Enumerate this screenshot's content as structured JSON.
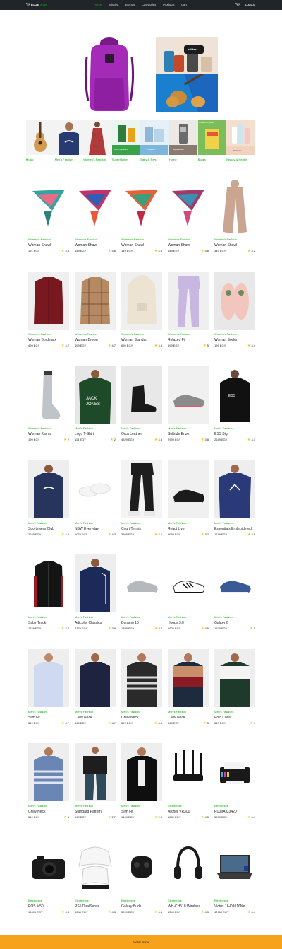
{
  "navbar": {
    "brand_fresh": "Fresh",
    "brand_cart": "Cart",
    "links": [
      "Home",
      "Wishlist",
      "Brands",
      "Categories",
      "Products",
      "Cart"
    ],
    "active_link": "Home",
    "logout": "Logout",
    "colors": {
      "bg": "#212529",
      "accent": "#0aad0a"
    }
  },
  "banners": {
    "side_top_brand": "adidas"
  },
  "categories": [
    "Music",
    "Men's Fashion",
    "Women's Fashion",
    "SuperMarket",
    "Baby & Toys",
    "Home",
    "Books",
    "Beauty & Health"
  ],
  "category_tiles": {
    "supermarket": "Food Cupboard",
    "baby": "Diapers",
    "home": "Appliances",
    "books": "Children's Books",
    "beauty": "Skincare"
  },
  "products": [
    {
      "category": "Women's Fashion",
      "name": "Woman Shawl",
      "price": "191 EGY",
      "rating": "4.8"
    },
    {
      "category": "Women's Fashion",
      "name": "Woman Shawl",
      "price": "149 EGY",
      "rating": "4.8"
    },
    {
      "category": "Women's Fashion",
      "name": "Woman Shawl",
      "price": "149 EGY",
      "rating": "4.8"
    },
    {
      "category": "Women's Fashion",
      "name": "Woman Shawl",
      "price": "149 EGY",
      "rating": "4.8"
    },
    {
      "category": "Women's Fashion",
      "name": "Woman Shawl",
      "price": "349 EGY",
      "rating": "4.2"
    },
    {
      "category": "Women's Fashion",
      "name": "Woman Bordeaux",
      "price": "499 EGY",
      "rating": "4.2"
    },
    {
      "category": "Women's Fashion",
      "name": "Woman Brown",
      "price": "499 EGY",
      "rating": "4.7"
    },
    {
      "category": "Women's Fashion",
      "name": "Woman Standart",
      "price": "699 EGY",
      "rating": "4.8"
    },
    {
      "category": "Women's Fashion",
      "name": "Relaxed Fit",
      "price": "699 EGY",
      "rating": "5"
    },
    {
      "category": "Women's Fashion",
      "name": "Woman Socks",
      "price": "199 EGY",
      "rating": "4.4"
    },
    {
      "category": "Women's Fashion",
      "name": "Woman Karma",
      "price": "199 EGY",
      "rating": "2"
    },
    {
      "category": "Men's Fashion",
      "name": "Logo T-Shirt",
      "price": "114 EGY",
      "rating": "2"
    },
    {
      "category": "Men's Fashion",
      "name": "Orca Leather",
      "price": "4829 EGY",
      "rating": "4.5"
    },
    {
      "category": "Men's Fashion",
      "name": "Softride Enzo",
      "price": "2999 EGY",
      "rating": "3.8"
    },
    {
      "category": "Men's Fashion",
      "name": "ESS Big",
      "price": "2649 EGY",
      "rating": "4.3"
    },
    {
      "category": "Men's Fashion",
      "name": "Sportswear Club",
      "price": "2649 EGY",
      "rating": "4.8"
    },
    {
      "category": "Men's Fashion",
      "name": "NSW Everyday",
      "price": "1079 EGY",
      "rating": "4.2"
    },
    {
      "category": "Men's Fashion",
      "name": "Court Tennis",
      "price": "3959 EGY",
      "rating": "2.6"
    },
    {
      "category": "Men's Fashion",
      "name": "React Live",
      "price": "4639 EGY",
      "rating": "3.7"
    },
    {
      "category": "Men's Fashion",
      "name": "Essentials Embroidered",
      "price": "1749 EGY",
      "rating": "3.8"
    },
    {
      "category": "Men's Fashion",
      "name": "Sabir Track",
      "price": "1748 EGY",
      "rating": "3.2"
    },
    {
      "category": "Men's Fashion",
      "name": "Adicolor Classics",
      "price": "2379 EGY",
      "rating": "3.8"
    },
    {
      "category": "Men's Fashion",
      "name": "Duramo 10",
      "price": "1889 EGY",
      "rating": "3.8"
    },
    {
      "category": "Men's Fashion",
      "name": "Hoops 3.0",
      "price": "1625 EGY",
      "rating": "4.5"
    },
    {
      "category": "Men's Fashion",
      "name": "Galaxy 6",
      "price": "1629 EGY",
      "rating": "5"
    },
    {
      "category": "Men's Fashion",
      "name": "Slim Fit",
      "price": "549 EGY",
      "rating": "4.7"
    },
    {
      "category": "Men's Fashion",
      "name": "Crew Neck",
      "price": "449 EGY",
      "rating": "4.7"
    },
    {
      "category": "Men's Fashion",
      "name": "Crew Neck",
      "price": "599 EGY",
      "rating": "4.5"
    },
    {
      "category": "Men's Fashion",
      "name": "Crew Neck",
      "price": "549 EGY",
      "rating": "5"
    },
    {
      "category": "Men's Fashion",
      "name": "Polo Collar",
      "price": "349 EGY",
      "rating": "4"
    },
    {
      "category": "Men's Fashion",
      "name": "Crew Neck",
      "price": "549 EGY",
      "rating": "3"
    },
    {
      "category": "Men's Fashion",
      "name": "Standard Pattern",
      "price": "699 EGY",
      "rating": "2.7"
    },
    {
      "category": "Men's Fashion",
      "name": "Slim Fit",
      "price": "1499 EGY",
      "rating": "2.6"
    },
    {
      "category": "Electronics",
      "name": "Archer VR300",
      "price": "1689 EGY",
      "rating": "4.5"
    },
    {
      "category": "Electronics",
      "name": "PIXMA G3420",
      "price": "5999 EGY",
      "rating": "4.4"
    },
    {
      "category": "Electronics",
      "name": "EOS M50",
      "price": "19699 EGY",
      "rating": "4.3"
    },
    {
      "category": "Electronics",
      "name": "PS5 DualSense",
      "price": "1048 EGY",
      "rating": "4.3"
    },
    {
      "category": "Electronics",
      "name": "Galaxy Buds",
      "price": "3999 EGY",
      "rating": "4.3"
    },
    {
      "category": "Electronics",
      "name": "WH-CH510 Wireless",
      "price": "1549 EGY",
      "rating": "4.3"
    },
    {
      "category": "Electronics",
      "name": "Victus 16-D1016Ne",
      "price": "42960 EGY",
      "rating": "4.4"
    }
  ],
  "footer": {
    "text": "Footer Name"
  }
}
